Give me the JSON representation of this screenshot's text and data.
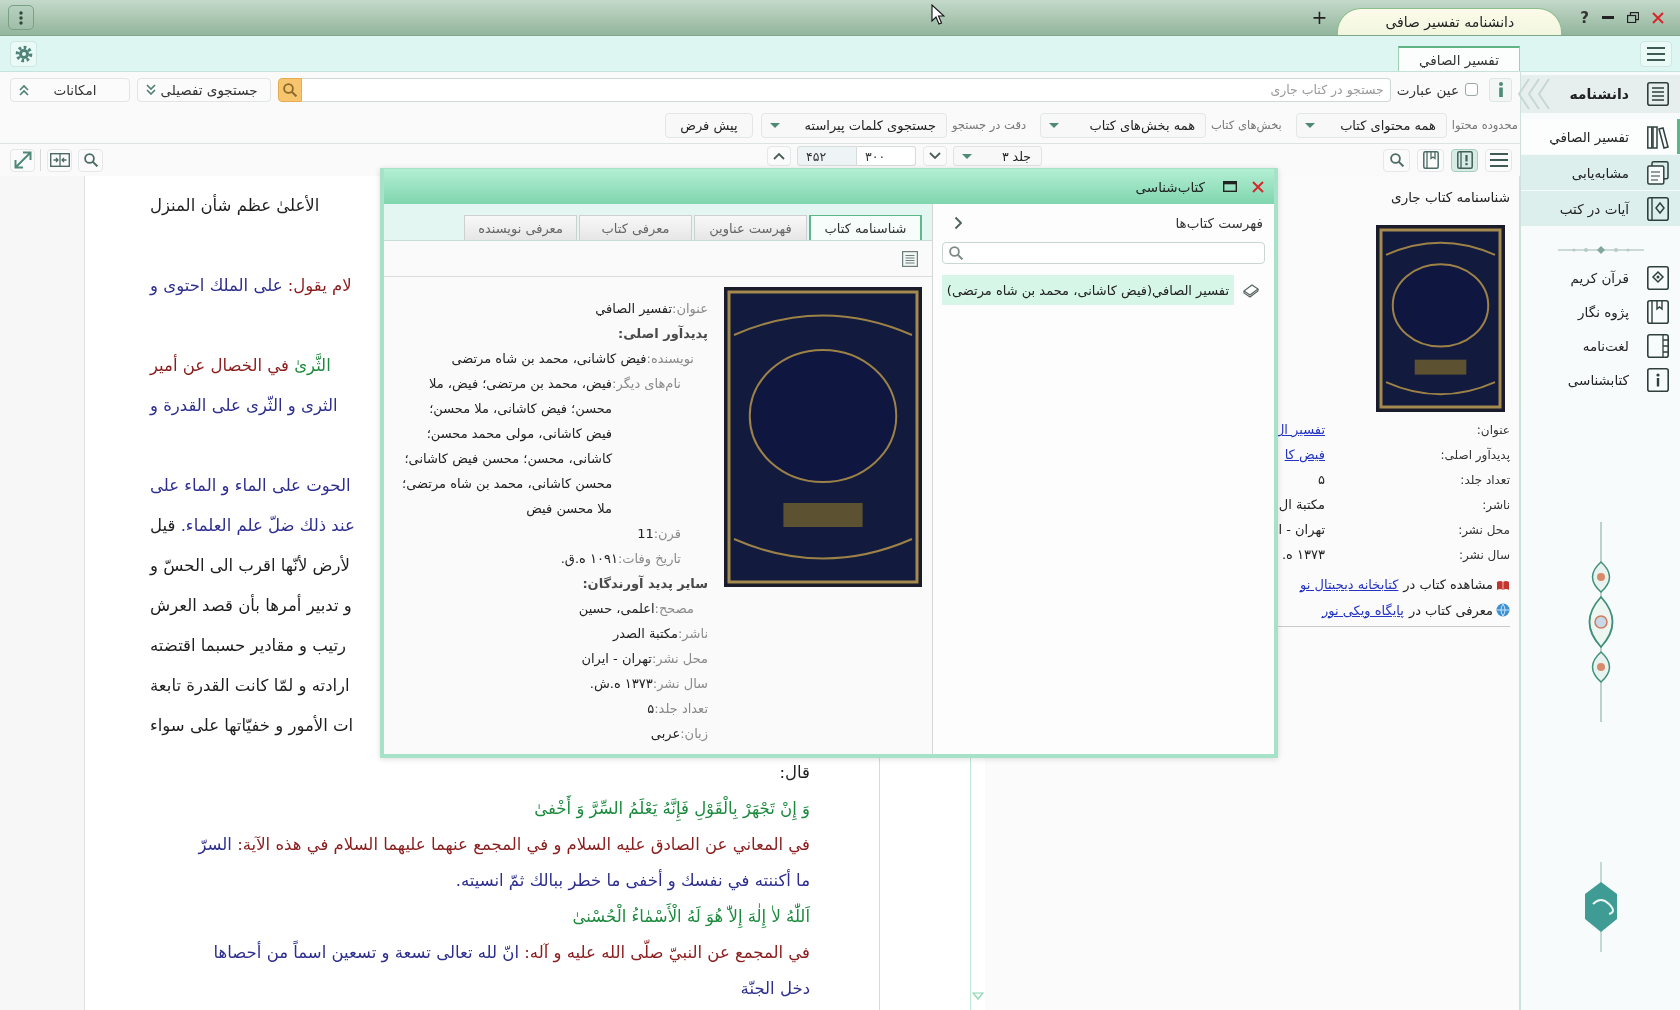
{
  "title_bar": {
    "new_tab": "+",
    "tabs": [
      {
        "label": "دانشنامه تفسیر صافی",
        "selected": true
      }
    ],
    "help": "?"
  },
  "document_tabs": [
    {
      "label": "تفسیر الصافي",
      "selected": true
    }
  ],
  "search_bar": {
    "features_button": "امکانات",
    "advanced_search_button": "جستجوی تفصیلی",
    "search_field": {
      "placeholder": "جستجو در کتاب جاری"
    },
    "exact_phrase": {
      "label": "عین عبارت",
      "checked": false
    }
  },
  "search_options": {
    "filters": [
      {
        "label": "محدوده محتوا",
        "value": "همه محتوای کتاب"
      },
      {
        "label": "بخش‌های کتاب",
        "value": "همه بخش‌های کتاب"
      },
      {
        "label": "دقت در جستجو",
        "value": "جستجوی کلمات پیراسته"
      }
    ],
    "default_button": "پیش فرض"
  },
  "navigation": {
    "page_count": "۴۵۲",
    "page": "۳۰۰",
    "volume": "جلد ۳"
  },
  "view_buttons": [
    {
      "selected": false
    },
    {
      "selected": true
    },
    {
      "selected": false
    },
    {
      "selected": false
    }
  ],
  "text": {
    "covered_paragraphs": [
      {
        "lines": [
          {
            "segments": [
              {
                "kind": "plain",
                "text": "الأعلىٰ عظم شأن المنزل"
              }
            ]
          }
        ]
      },
      {
        "lines": [
          {
            "segments": [
              {
                "kind": "source",
                "text": "لام يقول:"
              },
              {
                "kind": "hadith",
                "text": "على الملك احتوى و"
              }
            ]
          }
        ]
      },
      {
        "lines": [
          {
            "segments": [
              {
                "kind": "quran",
                "text": "الثَّرىٰ"
              },
              {
                "kind": "source",
                "text": "في الخصال عن أمير"
              }
            ]
          },
          {
            "segments": [
              {
                "kind": "hadith",
                "text": "الثرى و الثّرى على القدرة و"
              }
            ]
          }
        ]
      },
      {
        "lines": [
          {
            "segments": [
              {
                "kind": "hadith",
                "text": "الحوت على الماء و الماء على"
              }
            ]
          },
          {
            "segments": [
              {
                "kind": "hadith",
                "text": "عند ذلك ضلّ علم العلماء."
              },
              {
                "kind": "plain",
                "text": "قيل"
              }
            ]
          },
          {
            "segments": [
              {
                "kind": "plain",
                "text": "لأرض لأنّها اقرب الى الحسّ و"
              }
            ]
          },
          {
            "segments": [
              {
                "kind": "plain",
                "text": "و تدبير أمرها بأن قصد العرش"
              }
            ]
          },
          {
            "segments": [
              {
                "kind": "plain",
                "text": "رتيب و مقادير حسبما اقتضته"
              }
            ]
          },
          {
            "segments": [
              {
                "kind": "plain",
                "text": "ارادته و لمّا كانت القدرة تابعة"
              }
            ]
          },
          {
            "segments": [
              {
                "kind": "plain",
                "text": "ات الأمور و خفيّاتها على سواء"
              }
            ]
          }
        ]
      }
    ],
    "lines": [
      {
        "segments": [
          {
            "kind": "plain",
            "text": "قال:"
          }
        ]
      },
      {
        "segments": [
          {
            "kind": "quran",
            "text": "وَ إِنْ تَجْهَرْ بِالْقَوْلِ فَإِنَّهُ يَعْلَمُ السِّرَّ وَ أَخْفىٰ"
          }
        ]
      },
      {
        "segments": [
          {
            "kind": "source",
            "text": "في المعاني عن الصادق عليه السلام و في المجمع عنهما عليهما السلام في هذه الآية:"
          },
          {
            "kind": "hadith",
            "text": "السرّ"
          }
        ]
      },
      {
        "segments": [
          {
            "kind": "hadith",
            "text": "ما أكننته في نفسك و أخفى ما خطر ببالك ثمّ انسيته."
          }
        ]
      },
      {
        "segments": [
          {
            "kind": "quran",
            "text": "اَللّٰهُ لاٰ إِلٰهَ إِلاّٰ هُوَ لَهُ الْأَسْمٰاءُ الْحُسْنىٰ"
          }
        ]
      },
      {
        "segments": [
          {
            "kind": "source",
            "text": "في المجمع عن النبيّ صلّى الله عليه و آله:"
          },
          {
            "kind": "hadith",
            "text": "انّ لله تعالى تسعة و تسعين اسماً من أحصاها"
          }
        ]
      },
      {
        "segments": [
          {
            "kind": "hadith",
            "text": "دخل الجنّة"
          }
        ]
      }
    ]
  },
  "info_panel": {
    "title": "شناسنامه کتاب جاری",
    "fields": [
      {
        "label": "عنوان:",
        "value": "تفسیر ال",
        "kind": "link"
      },
      {
        "label": "پدیدآور اصلی:",
        "value": "فیض کا",
        "kind": "link"
      },
      {
        "label": "تعداد جلد:",
        "value": "۵",
        "kind": "text"
      },
      {
        "label": "ناشر:",
        "value": "مکتبة ال",
        "kind": "text"
      },
      {
        "label": "محل نشر:",
        "value": "تهران - ا",
        "kind": "text"
      },
      {
        "label": "سال نشر:",
        "value": "۱۳۷۳ ه.",
        "kind": "text"
      }
    ],
    "links": [
      {
        "text": "مشاهده کتاب در",
        "link": "کتابخانه دیجیتال نو"
      },
      {
        "text": "معرفی کتاب در",
        "link": "پایگاه ویکی نور"
      }
    ]
  },
  "sidebar": {
    "header": "دانشنامه",
    "items": [
      {
        "label": "تفسیر الصافي",
        "selected": true
      },
      {
        "label": "مشابه‌یابی",
        "selected": false
      },
      {
        "label": "آیات در کتب",
        "selected": false
      }
    ],
    "tools": [
      "قرآن کریم",
      "پژوه نگار",
      "لغت‌نامه",
      "کتابشناسی"
    ]
  },
  "dialog": {
    "title": "کتاب‌شناسی",
    "book_list": {
      "title": "فهرست کتاب‌ها",
      "items": [
        {
          "label": "تفسیر الصافي(فیض کاشانی، محمد بن شاه مرتضی)",
          "selected": true
        }
      ]
    },
    "tabs": [
      {
        "label": "شناسنامه کتاب",
        "selected": true
      },
      {
        "label": "فهرست عناوین",
        "selected": false
      },
      {
        "label": "معرفی کتاب",
        "selected": false
      },
      {
        "label": "معرفی نویسنده",
        "selected": false
      }
    ],
    "details": [
      {
        "label": "عنوان:",
        "value": "تفسیر الصافي"
      },
      {
        "label": "پدیدآور اصلی:",
        "children": [
          {
            "label": "نویسنده:",
            "value": "فیض کاشانی، محمد بن شاه مرتضی",
            "children": [
              {
                "label": "نام‌های دیگر:",
                "value": "فیض، محمد بن مرتضی؛ فیض، ملا محسن؛ فیض کاشانی، ملا محسن؛ فیض کاشانی، مولی محمد محسن؛ کاشانی، محسن؛ محسن فیض کاشانی؛ محسن کاشانی، محمد بن شاه مرتضی؛ ملا محسن فیض"
              },
              {
                "label": "قرن:",
                "value": "11"
              },
              {
                "label": "تاریخ وفات:",
                "value": "۱۰۹۱ ه.ق."
              }
            ]
          }
        ]
      },
      {
        "label": "سایر پدید آورندگان:",
        "children": [
          {
            "label": "مصحح:",
            "value": "اعلمی، حسین"
          }
        ]
      },
      {
        "label": "ناشر:",
        "value": "مکتبة الصدر"
      },
      {
        "label": "محل نشر:",
        "value": "تهران - ایران"
      },
      {
        "label": "سال نشر:",
        "value": "۱۳۷۳ ه.ش."
      },
      {
        "label": "تعداد جلد:",
        "value": "۵"
      },
      {
        "label": "زبان:",
        "value": "عربی"
      }
    ]
  }
}
